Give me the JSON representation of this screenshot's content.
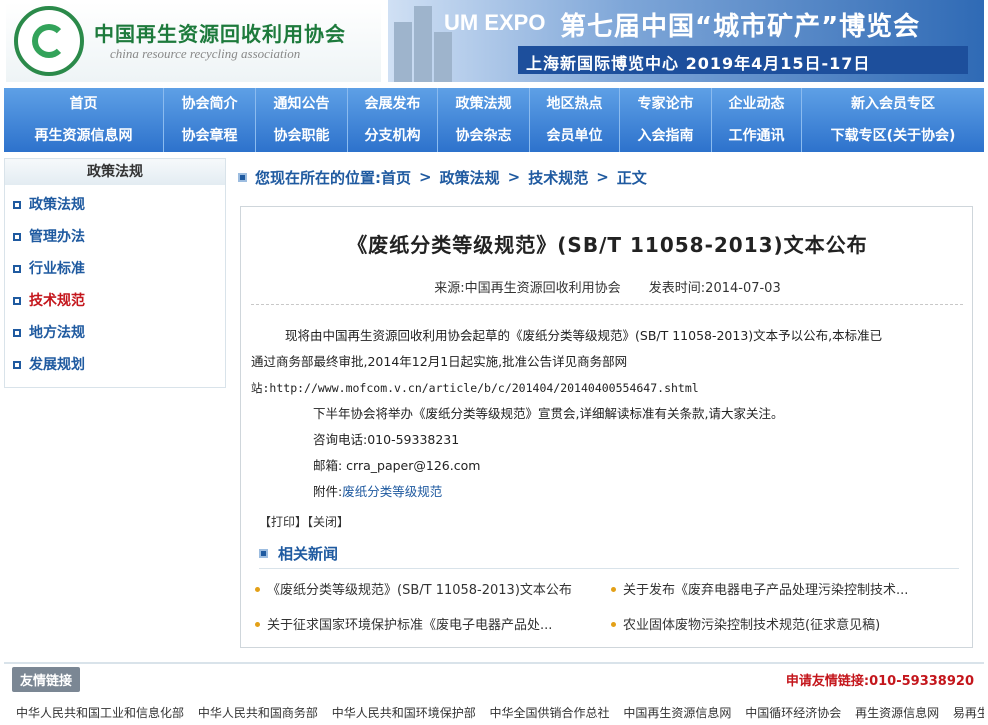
{
  "header": {
    "logo_cn": "中国再生资源回收利用协会",
    "logo_en": "china resource recycling association",
    "banner_en": "UM EXPO",
    "banner_cn": "第七届中国“城市矿产”博览会",
    "banner_sub": "上海新国际博览中心  2019年4月15日-17日"
  },
  "nav": {
    "row1": [
      "首页",
      "协会简介",
      "通知公告",
      "会展发布",
      "政策法规",
      "地区热点",
      "专家论市",
      "企业动态",
      "新入会员专区"
    ],
    "row2": [
      "再生资源信息网",
      "协会章程",
      "协会职能",
      "分支机构",
      "协会杂志",
      "会员单位",
      "入会指南",
      "工作通讯",
      "下载专区(关于协会)"
    ]
  },
  "sidebar": {
    "title": "政策法规",
    "items": [
      "政策法规",
      "管理办法",
      "行业标准",
      "技术规范",
      "地方法规",
      "发展规划"
    ]
  },
  "breadcrumb": {
    "prefix": "您现在所在的位置:",
    "items": [
      "首页",
      "政策法规",
      "技术规范",
      "正文"
    ]
  },
  "article": {
    "title": "《废纸分类等级规范》(SB/T 11058-2013)文本公布",
    "source": "来源:中国再生资源回收利用协会",
    "date": "发表时间:2014-07-03",
    "p1a": "现将由中国再生资源回收利用协会起草的《废纸分类等级规范》(SB/T 11058-2013)文本予以公布,本标准已",
    "p1b": "通过商务部最终审批,2014年12月1日起实施,批准公告详见商务部网",
    "p1c": "站:http://www.mofcom.v.cn/article/b/c/201404/20140400554647.shtml",
    "p2": "下半年协会将举办《废纸分类等级规范》宣贯会,详细解读标准有关条款,请大家关注。",
    "phone": "咨询电话:010-59338231",
    "email": "邮箱: crra_paper@126.com",
    "attach_label": "附件:",
    "attach_link": "废纸分类等级规范",
    "tools": "【打印】【关闭】"
  },
  "related": {
    "title": "相关新闻",
    "items": [
      "《废纸分类等级规范》(SB/T 11058-2013)文本公布",
      "关于发布《废弃电器电子产品处理污染控制技术...",
      "关于征求国家环境保护标准《废电子电器产品处...",
      "农业固体废物污染控制技术规范(征求意见稿)"
    ]
  },
  "links": {
    "label": "友情链接",
    "apply": "申请友情链接:010-59338920",
    "items": [
      "中华人民共和国工业和信息化部",
      "中华人民共和国商务部",
      "中华人民共和国环境保护部",
      "中华全国供销合作总社",
      "中国再生资源信息网",
      "中国循环经济协会",
      "再生资源信息网",
      "易再生网"
    ]
  }
}
